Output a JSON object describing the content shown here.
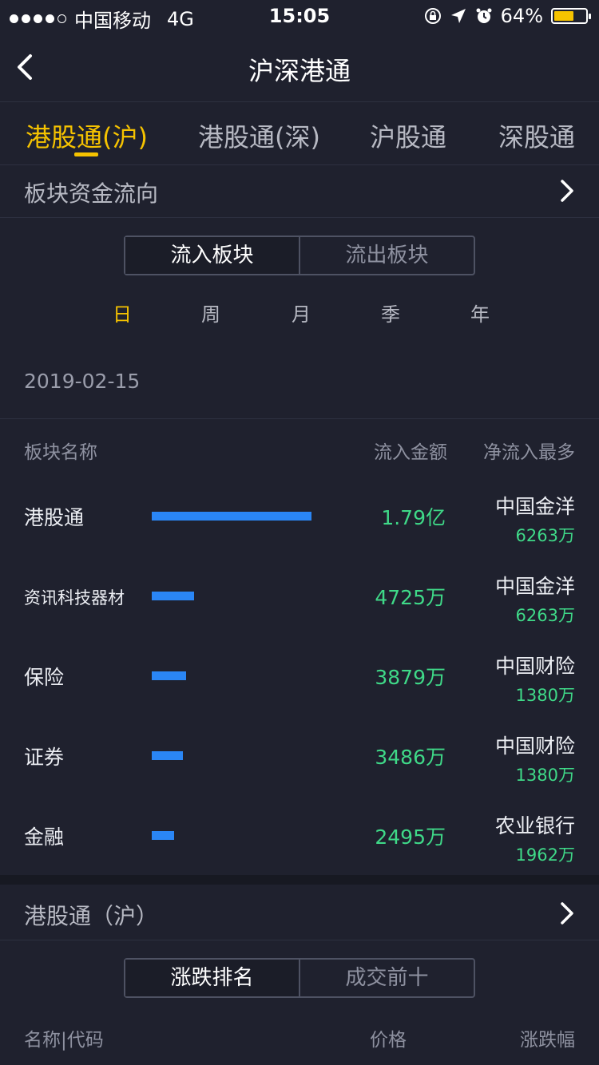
{
  "status_bar": {
    "carrier": "中国移动",
    "network": "4G",
    "time": "15:05",
    "battery_text": "64%",
    "battery_level": 0.64
  },
  "nav": {
    "title": "沪深港通"
  },
  "tabs": [
    {
      "label": "港股通(沪)",
      "active": true
    },
    {
      "label": "港股通(深)",
      "active": false
    },
    {
      "label": "沪股通",
      "active": false
    },
    {
      "label": "深股通",
      "active": false
    }
  ],
  "sector_flow": {
    "header": "板块资金流向",
    "segment": {
      "options": [
        "流入板块",
        "流出板块"
      ],
      "selected": "流入板块"
    },
    "periods": [
      {
        "label": "日",
        "active": true
      },
      {
        "label": "周",
        "active": false
      },
      {
        "label": "月",
        "active": false
      },
      {
        "label": "季",
        "active": false
      },
      {
        "label": "年",
        "active": false
      }
    ],
    "date": "2019-02-15",
    "columns": [
      "板块名称",
      "流入金额",
      "净流入最多"
    ],
    "rows": [
      {
        "name": "港股通",
        "amount": "1.79亿",
        "bar_ratio": 1.0,
        "top_name": "中国金洋",
        "top_value": "6263万"
      },
      {
        "name": "资讯科技器材",
        "amount": "4725万",
        "bar_ratio": 0.264,
        "top_name": "中国金洋",
        "top_value": "6263万"
      },
      {
        "name": "保险",
        "amount": "3879万",
        "bar_ratio": 0.217,
        "top_name": "中国财险",
        "top_value": "1380万"
      },
      {
        "name": "证券",
        "amount": "3486万",
        "bar_ratio": 0.195,
        "top_name": "中国财险",
        "top_value": "1380万"
      },
      {
        "name": "金融",
        "amount": "2495万",
        "bar_ratio": 0.139,
        "top_name": "农业银行",
        "top_value": "1962万"
      }
    ]
  },
  "hk_connect": {
    "header": "港股通（沪）",
    "segment": {
      "options": [
        "涨跌排名",
        "成交前十"
      ],
      "selected": "涨跌排名"
    },
    "columns": [
      "名称|代码",
      "价格",
      "涨跌幅"
    ]
  },
  "colors": {
    "background": "#1f212e",
    "accent_yellow": "#f6c300",
    "bar_blue": "#2a86f5",
    "positive_green": "#3fd988"
  }
}
